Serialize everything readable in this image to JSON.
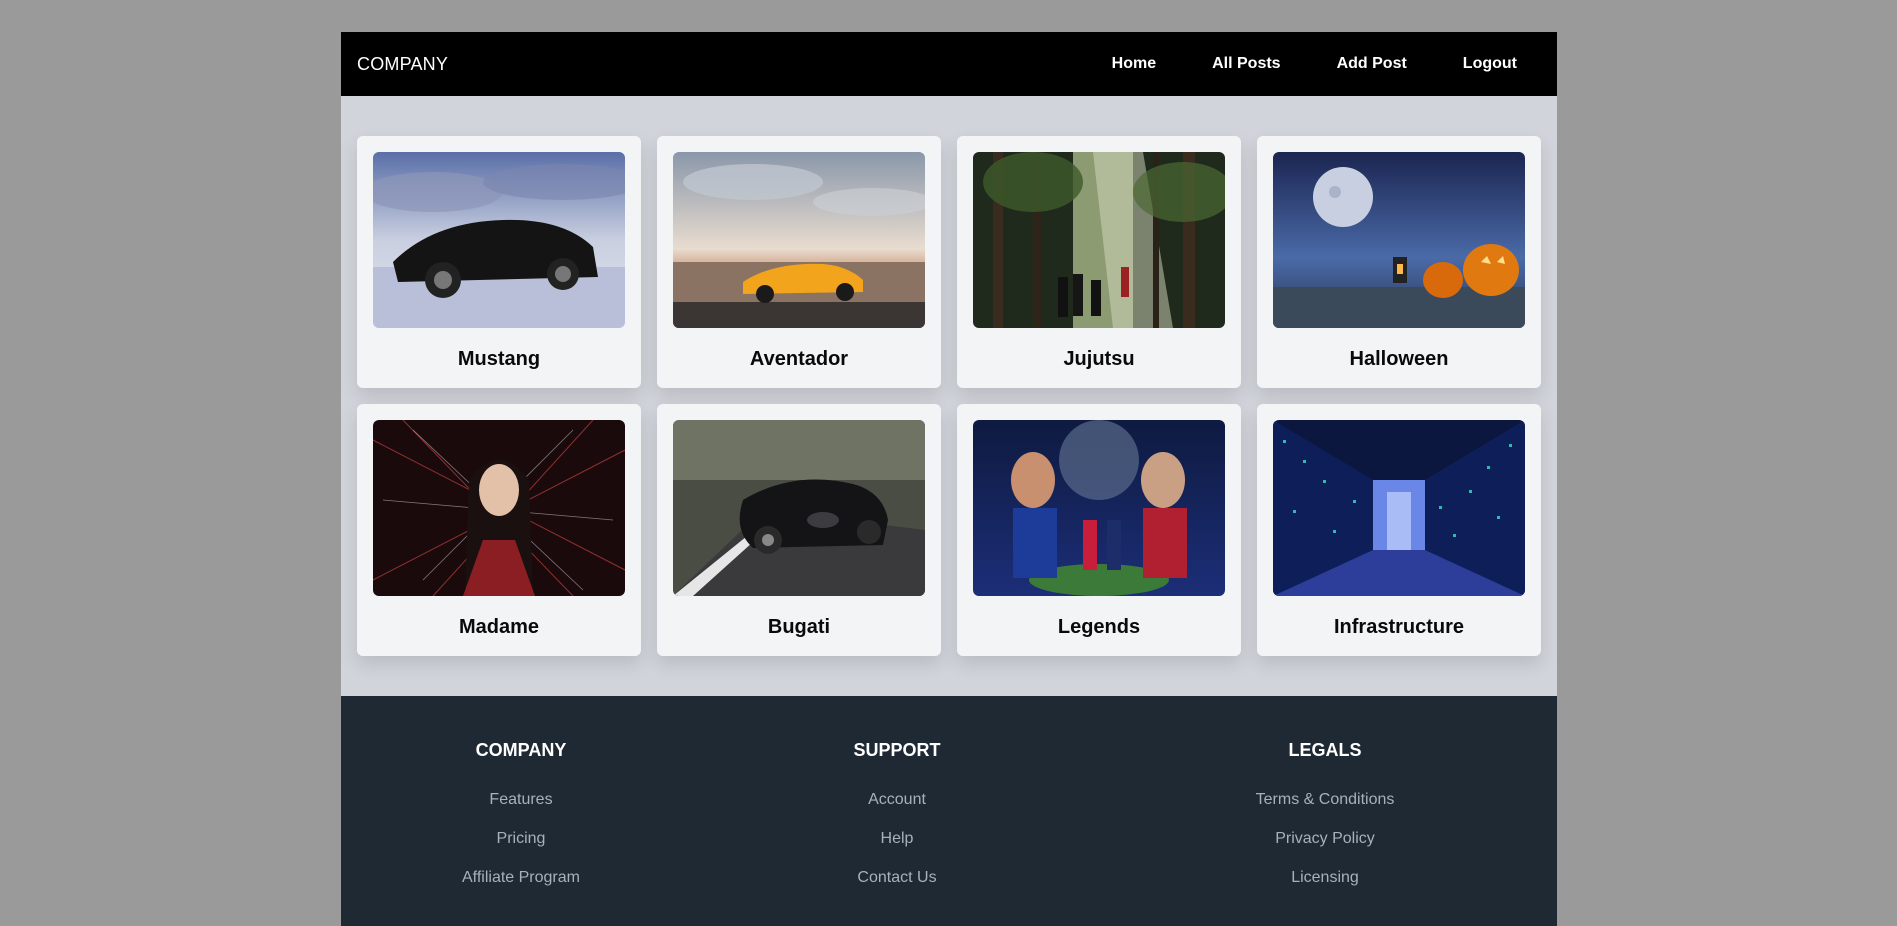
{
  "header": {
    "brand": "COMPANY",
    "nav": [
      {
        "label": "Home"
      },
      {
        "label": "All Posts"
      },
      {
        "label": "Add Post"
      },
      {
        "label": "Logout"
      }
    ]
  },
  "posts": [
    {
      "title": "Mustang"
    },
    {
      "title": "Aventador"
    },
    {
      "title": "Jujutsu"
    },
    {
      "title": "Halloween"
    },
    {
      "title": "Madame"
    },
    {
      "title": "Bugati"
    },
    {
      "title": "Legends"
    },
    {
      "title": "Infrastructure"
    }
  ],
  "footer": {
    "columns": [
      {
        "heading": "COMPANY",
        "links": [
          "Features",
          "Pricing",
          "Affiliate Program"
        ]
      },
      {
        "heading": "SUPPORT",
        "links": [
          "Account",
          "Help",
          "Contact Us"
        ]
      },
      {
        "heading": "LEGALS",
        "links": [
          "Terms & Conditions",
          "Privacy Policy",
          "Licensing"
        ]
      }
    ]
  }
}
